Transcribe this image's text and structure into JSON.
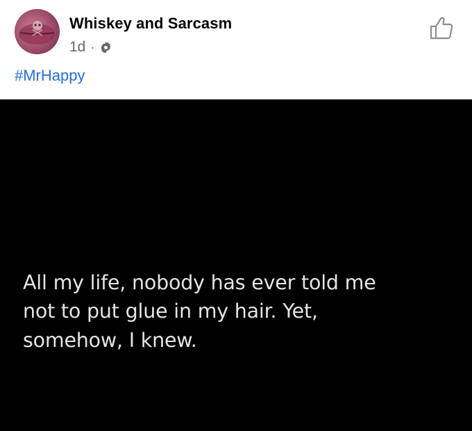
{
  "post": {
    "page_name": "Whiskey and Sarcasm",
    "time": "1d",
    "separator": "·",
    "audience_icon": "gear-icon",
    "hashtag": "#MrHappy",
    "like_icon": "thumbs-up-icon",
    "avatar_icon": "lips-avatar"
  },
  "image": {
    "quote": "All my life, nobody has ever told me\nnot to put glue in my hair. Yet,\nsomehow, I knew."
  },
  "colors": {
    "link": "#216fdb",
    "meta": "#65676b",
    "image_background": "#000000",
    "quote_text": "#e4e4e4"
  }
}
